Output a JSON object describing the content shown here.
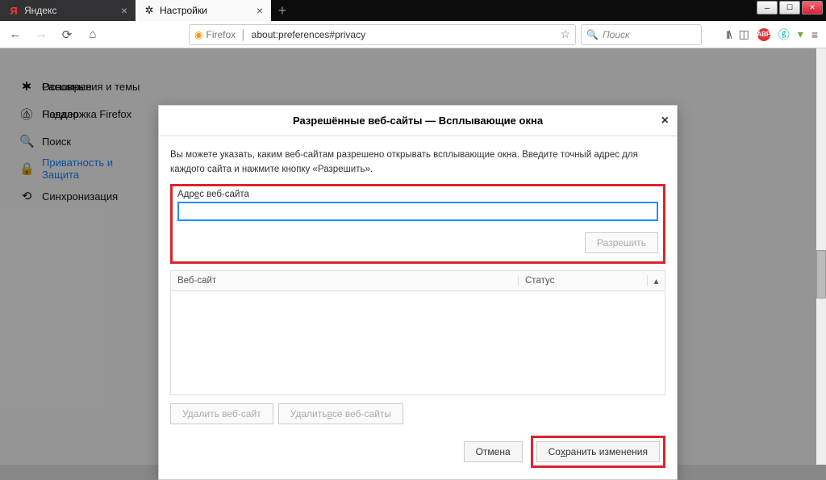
{
  "tabs": {
    "t0": {
      "label": "Яндекс"
    },
    "t1": {
      "label": "Настройки"
    }
  },
  "urlbar": {
    "identity": "Firefox",
    "url": "about:preferences#privacy"
  },
  "searchbar": {
    "placeholder": "Поиск"
  },
  "sidebar": {
    "general": "Основные",
    "home": "Начало",
    "search": "Поиск",
    "privacy": "Приватность и Защита",
    "sync": "Синхронизация",
    "extensions": "Расширения и темы",
    "support": "Поддержка Firefox"
  },
  "dialog": {
    "title": "Разрешённые веб-сайты — Всплывающие окна",
    "desc": "Вы можете указать, каким веб-сайтам разрешено открывать всплывающие окна. Введите точный адрес для каждого сайта и нажмите кнопку «Разрешить».",
    "field_prefix": "Адр",
    "field_u": "е",
    "field_suffix": "с веб-сайта",
    "allow": "Разрешить",
    "col_site": "Веб-сайт",
    "col_status": "Статус",
    "remove_one": "Удалить веб-сайт",
    "remove_all_prefix": "Удалить ",
    "remove_all_u": "в",
    "remove_all_suffix": "се веб-сайты",
    "cancel": "Отмена",
    "save_prefix": "Со",
    "save_u": "х",
    "save_suffix": "ранить изменения"
  }
}
